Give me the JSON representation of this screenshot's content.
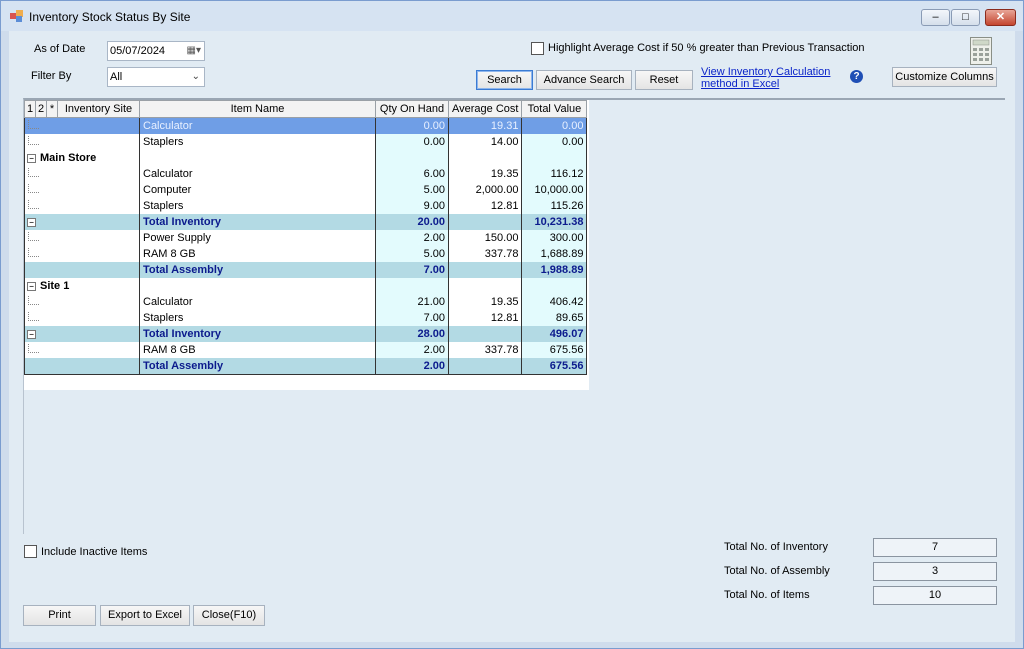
{
  "window": {
    "title": "Inventory Stock Status By Site",
    "min_glyph": "–",
    "max_glyph": "□",
    "close_glyph": "✕"
  },
  "filters": {
    "as_of_date_label": "As of Date",
    "as_of_date_value": "05/07/2024",
    "filter_by_label": "Filter By",
    "filter_by_value": "All",
    "highlight_label": "Highlight Average Cost if 50 % greater than Previous Transaction",
    "highlight_checked": false
  },
  "buttons": {
    "search": "Search",
    "advance_search": "Advance Search",
    "reset": "Reset",
    "customize_columns": "Customize Columns",
    "print": "Print",
    "export": "Export to Excel",
    "close": "Close(F10)"
  },
  "links": {
    "view_calc_line1": "View Inventory Calculation",
    "view_calc_line2": "method in Excel"
  },
  "help_glyph": "?",
  "grid": {
    "headers": {
      "level1": "1",
      "level2": "2",
      "star": "*",
      "site": "Inventory Site",
      "item": "Item Name",
      "qty": "Qty On Hand",
      "avg": "Average Cost",
      "total": "Total Value"
    },
    "rows": [
      {
        "type": "item",
        "selected": true,
        "item": "Calculator",
        "qty": "0.00",
        "avg": "19.31",
        "total": "0.00"
      },
      {
        "type": "item",
        "item": "Staplers",
        "qty": "0.00",
        "avg": "14.00",
        "total": "0.00"
      },
      {
        "type": "group",
        "site": "Main Store"
      },
      {
        "type": "item",
        "item": "Calculator",
        "qty": "6.00",
        "avg": "19.35",
        "total": "116.12"
      },
      {
        "type": "item",
        "item": "Computer",
        "qty": "5.00",
        "avg": "2,000.00",
        "total": "10,000.00"
      },
      {
        "type": "item",
        "item": "Staplers",
        "qty": "9.00",
        "avg": "12.81",
        "total": "115.26"
      },
      {
        "type": "subtotal",
        "item": "Total Inventory",
        "qty": "20.00",
        "avg": "",
        "total": "10,231.38"
      },
      {
        "type": "item",
        "item": "Power Supply",
        "qty": "2.00",
        "avg": "150.00",
        "total": "300.00"
      },
      {
        "type": "item",
        "item": "RAM 8 GB",
        "qty": "5.00",
        "avg": "337.78",
        "total": "1,688.89"
      },
      {
        "type": "subtotal",
        "item": "Total Assembly",
        "qty": "7.00",
        "avg": "",
        "total": "1,988.89",
        "noexp": true
      },
      {
        "type": "group",
        "site": "Site 1"
      },
      {
        "type": "item",
        "item": "Calculator",
        "qty": "21.00",
        "avg": "19.35",
        "total": "406.42"
      },
      {
        "type": "item",
        "item": "Staplers",
        "qty": "7.00",
        "avg": "12.81",
        "total": "89.65"
      },
      {
        "type": "subtotal",
        "item": "Total Inventory",
        "qty": "28.00",
        "avg": "",
        "total": "496.07"
      },
      {
        "type": "item",
        "item": "RAM 8 GB",
        "qty": "2.00",
        "avg": "337.78",
        "total": "675.56"
      },
      {
        "type": "subtotal",
        "item": "Total Assembly",
        "qty": "2.00",
        "avg": "",
        "total": "675.56",
        "noexp": true
      }
    ]
  },
  "footer": {
    "include_inactive_label": "Include Inactive Items",
    "include_inactive_checked": false,
    "stats": [
      {
        "label": "Total No. of Inventory",
        "value": "7"
      },
      {
        "label": "Total No. of Assembly",
        "value": "3"
      },
      {
        "label": "Total No. of Items",
        "value": "10"
      }
    ]
  }
}
